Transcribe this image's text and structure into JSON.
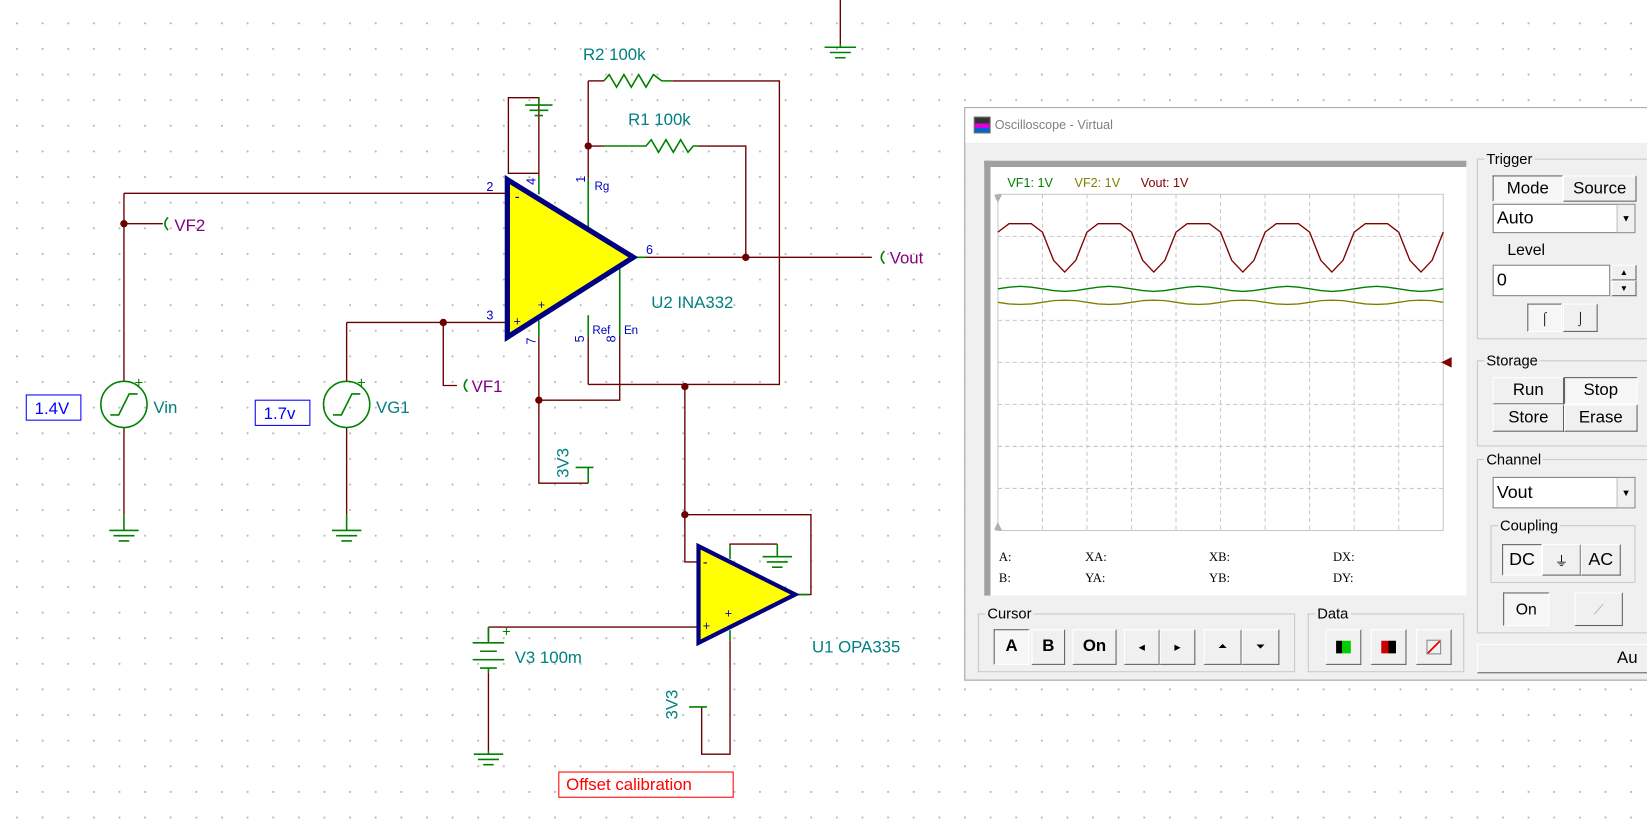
{
  "schematic": {
    "r2": "R2 100k",
    "r1": "R1 100k",
    "u2": "U2 INA332",
    "u1": "U1 OPA335",
    "v3": "V3 100m",
    "vin": "Vin",
    "vg1": "VG1",
    "vin_value": "1.4V",
    "vg1_value": "1.7v",
    "vf1": "VF1",
    "vf2": "VF2",
    "vout": "Vout",
    "supply_u2": "3V3",
    "supply_u1": "3V3",
    "offset_label": "Offset calibration",
    "pins": {
      "p1": "1",
      "p2": "2",
      "p3": "3",
      "p4": "4",
      "p5": "5",
      "p6": "6",
      "p7": "7",
      "p8": "8",
      "rg": "Rg",
      "ref": "Ref",
      "en": "En",
      "minus": "-",
      "plus": "+"
    },
    "colors": {
      "wire": "#800000",
      "lead": "#008000",
      "opamp_fill": "#ffff00",
      "opamp_outline": "#000080",
      "component_label": "#008080",
      "net_label": "#800080",
      "pin_label": "#0000c0",
      "value_box": "#0000ff",
      "note": "#ff0000"
    }
  },
  "oscilloscope": {
    "title": "Oscilloscope - Virtual",
    "channels": [
      {
        "label": "VF1: 1V",
        "color": "#008000"
      },
      {
        "label": "VF2: 1V",
        "color": "#808000"
      },
      {
        "label": "Vout: 1V",
        "color": "#800000"
      }
    ],
    "readouts": {
      "a": "A:",
      "b": "B:",
      "xa": "XA:",
      "ya": "YA:",
      "xb": "XB:",
      "yb": "YB:",
      "dx": "DX:",
      "dy": "DY:"
    },
    "trigger": {
      "title": "Trigger",
      "mode": "Mode",
      "source": "Source",
      "mode_value": "Auto",
      "level_label": "Level",
      "level_value": "0",
      "rising_icon": "rising-edge-icon",
      "falling_icon": "falling-edge-icon"
    },
    "storage": {
      "title": "Storage",
      "run": "Run",
      "stop": "Stop",
      "store": "Store",
      "erase": "Erase"
    },
    "channel": {
      "title": "Channel",
      "value": "Vout",
      "coupling_title": "Coupling",
      "dc": "DC",
      "gnd": "⏚",
      "ac": "AC",
      "on": "On",
      "probe_icon": "probe-icon"
    },
    "auto_button": "Au",
    "cursor": {
      "title": "Cursor",
      "a": "A",
      "b": "B",
      "on": "On",
      "left": "◂",
      "right": "▸",
      "up": "⏶",
      "down": "⏷"
    },
    "data": {
      "title": "Data",
      "icons": [
        "import-data-icon",
        "export-data-icon",
        "diagram-icon"
      ]
    }
  },
  "chart_data": {
    "type": "line",
    "x_divisions": 10,
    "y_divisions": 8,
    "y_per_div": 1,
    "y_unit": "V",
    "grid": true,
    "x_step_div": 0.25,
    "series": [
      {
        "name": "Vout: 1V",
        "color": "#800000",
        "values": [
          3.1,
          3.3,
          3.3,
          3.3,
          3.1,
          2.43,
          2.15,
          2.43,
          3.1,
          3.3,
          3.3,
          3.3,
          3.1,
          2.43,
          2.15,
          2.43,
          3.1,
          3.3,
          3.3,
          3.3,
          3.1,
          2.43,
          2.15,
          2.43,
          3.1,
          3.3,
          3.3,
          3.3,
          3.1,
          2.43,
          2.15,
          2.43,
          3.1,
          3.3,
          3.3,
          3.3,
          3.1,
          2.43,
          2.15,
          2.43,
          3.1
        ]
      },
      {
        "name": "VF1: 1V",
        "color": "#008000",
        "values": [
          1.75,
          1.79,
          1.81,
          1.79,
          1.75,
          1.71,
          1.69,
          1.71,
          1.75,
          1.79,
          1.81,
          1.79,
          1.75,
          1.71,
          1.69,
          1.71,
          1.75,
          1.79,
          1.81,
          1.79,
          1.75,
          1.71,
          1.69,
          1.71,
          1.75,
          1.79,
          1.81,
          1.79,
          1.75,
          1.71,
          1.69,
          1.71,
          1.75,
          1.79,
          1.81,
          1.79,
          1.75,
          1.71,
          1.69,
          1.71,
          1.75
        ]
      },
      {
        "name": "VF2: 1V",
        "color": "#808000",
        "values": [
          1.43,
          1.39,
          1.38,
          1.39,
          1.43,
          1.47,
          1.48,
          1.47,
          1.43,
          1.39,
          1.38,
          1.39,
          1.43,
          1.47,
          1.48,
          1.47,
          1.43,
          1.39,
          1.38,
          1.39,
          1.43,
          1.47,
          1.48,
          1.47,
          1.43,
          1.39,
          1.38,
          1.39,
          1.43,
          1.47,
          1.48,
          1.47,
          1.43,
          1.39,
          1.38,
          1.39,
          1.43,
          1.47,
          1.48,
          1.47,
          1.43
        ]
      }
    ]
  }
}
